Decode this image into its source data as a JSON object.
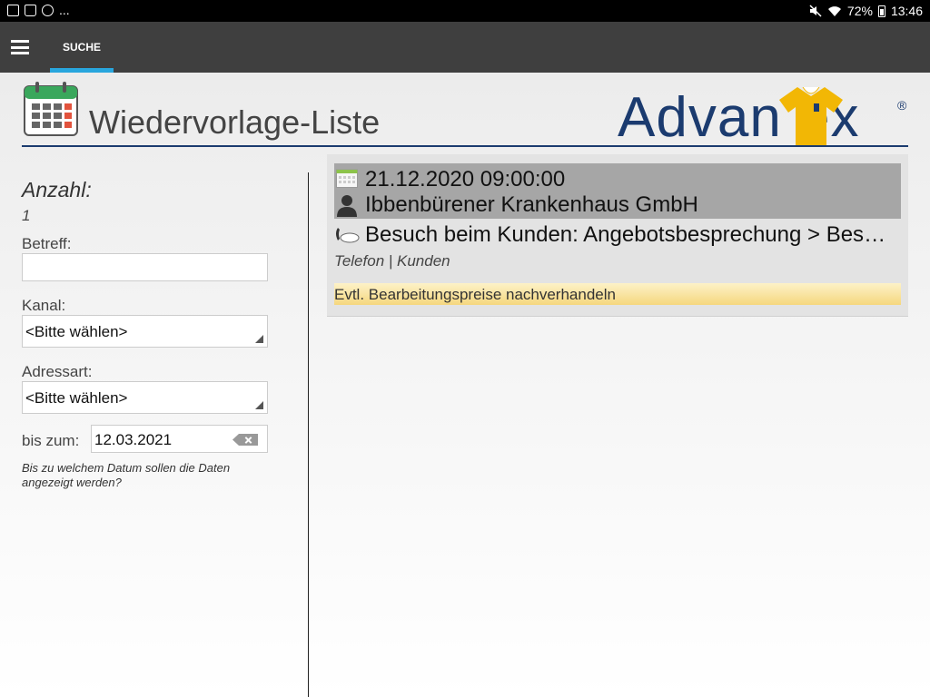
{
  "status_bar": {
    "overflow": "...",
    "battery": "72%",
    "time": "13:46"
  },
  "appbar": {
    "tab_label": "SUCHE"
  },
  "header": {
    "title": "Wiedervorlage-Liste",
    "logo_text": "Advan  ex",
    "logo_reg": "®"
  },
  "filters": {
    "count_label": "Anzahl:",
    "count_value": "1",
    "subject_label": "Betreff:",
    "subject_value": "",
    "channel_label": "Kanal:",
    "channel_value": "<Bitte wählen>",
    "address_label": "Adressart:",
    "address_value": "<Bitte wählen>",
    "date_label": "bis zum:",
    "date_value": "12.03.2021",
    "hint": "Bis zu welchem Datum sollen die Daten angezeigt werden?"
  },
  "result": {
    "date": "21.12.2020 09:00:00",
    "company": "Ibbenbürener Krankenhaus GmbH",
    "subject": "Besuch beim Kunden: Angebotsbesprechung > Besuch beim Kunden",
    "meta": "Telefon | Kunden",
    "note": "Evtl. Bearbeitungspreise nachverhandeln"
  },
  "colors": {
    "appbar": "#3f3f3f",
    "tab_indicator": "#29a6dd",
    "brand_blue": "#1b3b6f",
    "brand_yellow": "#f2b705",
    "note_bg": "#f5d77e",
    "card_head": "#a6a6a6"
  },
  "icons": [
    "image-icon",
    "clipboard-icon",
    "sync-icon",
    "mute-icon",
    "wifi-icon",
    "battery-icon",
    "menu-icon",
    "calendar-icon",
    "person-icon",
    "phone-icon",
    "clear-icon"
  ]
}
